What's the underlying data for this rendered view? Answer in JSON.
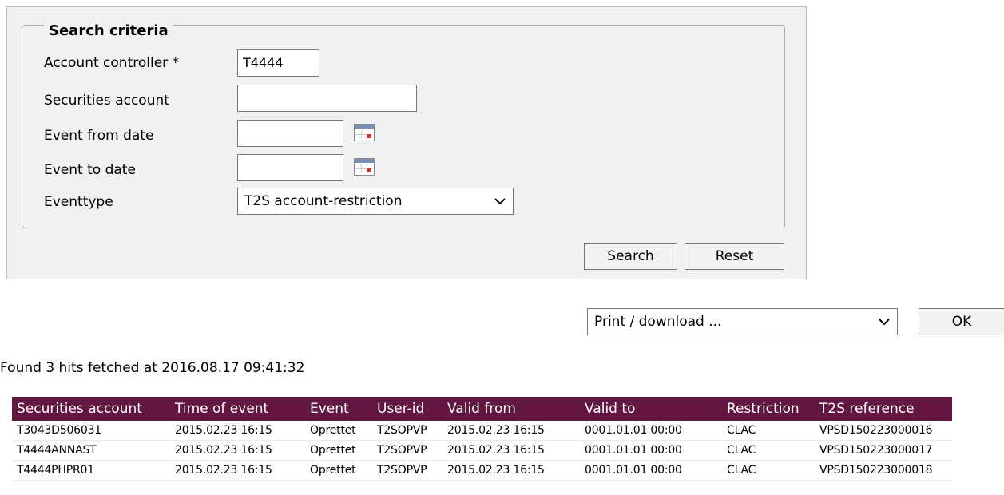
{
  "search": {
    "legend": "Search criteria",
    "fields": {
      "account_controller": {
        "label": "Account controller *",
        "value": "T4444"
      },
      "securities_account": {
        "label": "Securities account",
        "value": ""
      },
      "event_from_date": {
        "label": "Event from date",
        "value": ""
      },
      "event_to_date": {
        "label": "Event to date",
        "value": ""
      },
      "eventtype": {
        "label": "Eventtype",
        "value": "T2S account-restriction"
      }
    },
    "search_button": "Search",
    "reset_button": "Reset"
  },
  "output": {
    "selected": "Print / download ...",
    "ok_button": "OK"
  },
  "status": "Found 3 hits fetched at 2016.08.17 09:41:32",
  "table": {
    "headers": [
      "Securities account",
      "Time of event",
      "Event",
      "User-id",
      "Valid from",
      "Valid to",
      "Restriction",
      "T2S reference"
    ],
    "rows": [
      [
        "T3043D506031",
        "2015.02.23 16:15",
        "Oprettet",
        "T2SOPVP",
        "2015.02.23 16:15",
        "0001.01.01 00:00",
        "CLAC",
        "VPSD150223000016"
      ],
      [
        "T4444ANNAST",
        "2015.02.23 16:15",
        "Oprettet",
        "T2SOPVP",
        "2015.02.23 16:15",
        "0001.01.01 00:00",
        "CLAC",
        "VPSD150223000017"
      ],
      [
        "T4444PHPR01",
        "2015.02.23 16:15",
        "Oprettet",
        "T2SOPVP",
        "2015.02.23 16:15",
        "0001.01.01 00:00",
        "CLAC",
        "VPSD150223000018"
      ]
    ]
  },
  "colors": {
    "header_bg": "#63163f",
    "panel_bg": "#f1f1f1"
  }
}
